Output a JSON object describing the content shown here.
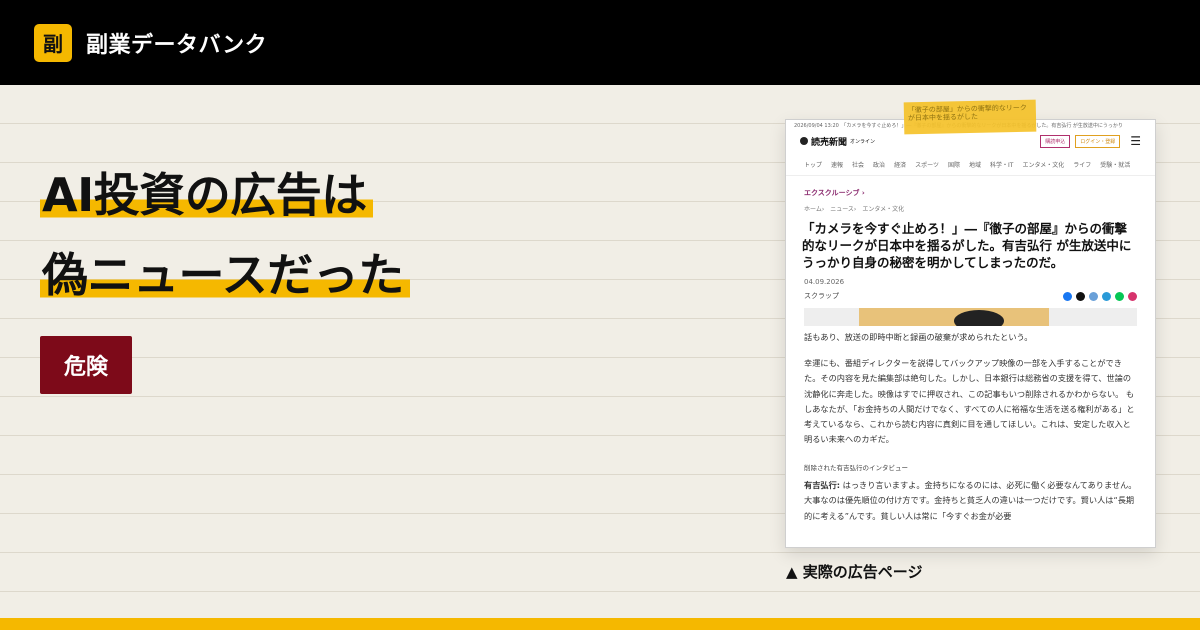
{
  "site": {
    "logo_glyph": "副",
    "name": "副業データバンク"
  },
  "headline": {
    "line1": "AI投資の広告は",
    "line2": "偽ニュースだった"
  },
  "badge": "危険",
  "caption": "▲ 実際の広告ページ",
  "colors": {
    "accent": "#f5b800",
    "badge": "#7d0a19",
    "topbar": "#000000",
    "background": "#f1eee6"
  },
  "article": {
    "top_strip": "2026/09/04 13:20　「カメラを今すぐ止めろ！」―『徹子の部屋』からの衝撃的なリークが日本中を揺るがした。有吉弘行 が生放送中にうっかり",
    "tape_text": "「徹子の部屋」からの衝撃的なリークが日本中を揺るがした",
    "brand": "読売新聞",
    "brand_sub": "オンライン",
    "login_btn": "購読申込",
    "login_btn2": "ログイン・登録",
    "nav": [
      "トップ",
      "速報",
      "社会",
      "政治",
      "経済",
      "スポーツ",
      "国際",
      "地域",
      "科学・IT",
      "エンタメ・文化",
      "ライフ",
      "受験・就活"
    ],
    "section": "エクスクルーシブ ›",
    "breadcrumb": "ホーム›　ニュース›　エンタメ・文化",
    "title": "「カメラを今すぐ止めろ！」―『徹子の部屋』からの衝撃的なリークが日本中を揺るがした。有吉弘行 が生放送中にうっかり自身の秘密を明かしてしまったのだ。",
    "date": "04.09.2026",
    "scrap": "スクラップ",
    "para1": "話もあり、放送の即時中断と録画の破棄が求められたという。",
    "para2": "幸運にも、番組ディレクターを説得してバックアップ映像の一部を入手することができた。その内容を見た編集部は絶句した。しかし、日本銀行は総務省の支援を得て、世論の沈静化に奔走した。映像はすでに押収され、この記事もいつ削除されるかわからない。 もしあなたが、「お金持ちの人間だけでなく、すべての人に裕福な生活を送る権利がある」と考えているなら、これから読む内容に真剣に目を通してほしい。これは、安定した収入と明るい未来へのカギだ。",
    "subhead": "削除された有吉弘行のインタビュー",
    "speaker": "有吉弘行:",
    "para3": "はっきり言いますよ。金持ちになるのには、必死に働く必要なんてありません。大事なのは優先順位の付け方です。金持ちと貧乏人の違いは一つだけです。賢い人は“長期的に考える”んです。貧しい人は常に「今すぐお金が必要"
  }
}
